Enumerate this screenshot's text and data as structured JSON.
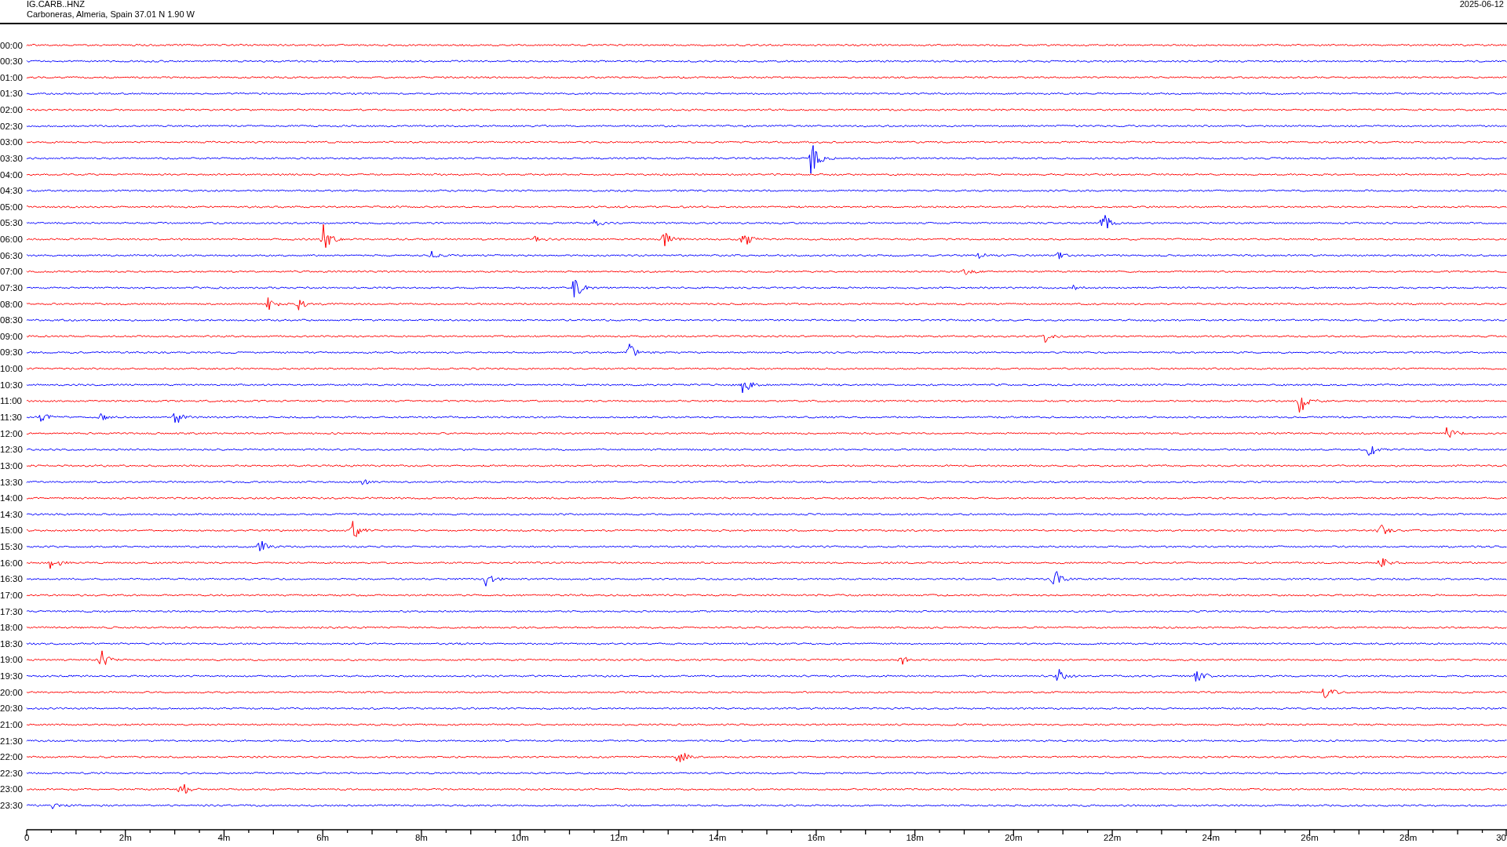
{
  "header": {
    "station": "IG.CARB..HNZ",
    "location": "Carboneras, Almeria, Spain  37.01 N 1.90 W",
    "date": "2025-06-12"
  },
  "rows": [
    {
      "time": "00:00",
      "color": "#ff0000"
    },
    {
      "time": "00:30",
      "color": "#0000ff"
    },
    {
      "time": "01:00",
      "color": "#ff0000"
    },
    {
      "time": "01:30",
      "color": "#0000ff"
    },
    {
      "time": "02:00",
      "color": "#ff0000"
    },
    {
      "time": "02:30",
      "color": "#0000ff"
    },
    {
      "time": "03:00",
      "color": "#ff0000"
    },
    {
      "time": "03:30",
      "color": "#0000ff"
    },
    {
      "time": "04:00",
      "color": "#ff0000"
    },
    {
      "time": "04:30",
      "color": "#0000ff"
    },
    {
      "time": "05:00",
      "color": "#ff0000"
    },
    {
      "time": "05:30",
      "color": "#0000ff"
    },
    {
      "time": "06:00",
      "color": "#ff0000"
    },
    {
      "time": "06:30",
      "color": "#0000ff"
    },
    {
      "time": "07:00",
      "color": "#ff0000"
    },
    {
      "time": "07:30",
      "color": "#0000ff"
    },
    {
      "time": "08:00",
      "color": "#ff0000"
    },
    {
      "time": "08:30",
      "color": "#0000ff"
    },
    {
      "time": "09:00",
      "color": "#ff0000"
    },
    {
      "time": "09:30",
      "color": "#0000ff"
    },
    {
      "time": "10:00",
      "color": "#ff0000"
    },
    {
      "time": "10:30",
      "color": "#0000ff"
    },
    {
      "time": "11:00",
      "color": "#ff0000"
    },
    {
      "time": "11:30",
      "color": "#0000ff"
    },
    {
      "time": "12:00",
      "color": "#ff0000"
    },
    {
      "time": "12:30",
      "color": "#0000ff"
    },
    {
      "time": "13:00",
      "color": "#ff0000"
    },
    {
      "time": "13:30",
      "color": "#0000ff"
    },
    {
      "time": "14:00",
      "color": "#ff0000"
    },
    {
      "time": "14:30",
      "color": "#0000ff"
    },
    {
      "time": "15:00",
      "color": "#ff0000"
    },
    {
      "time": "15:30",
      "color": "#0000ff"
    },
    {
      "time": "16:00",
      "color": "#ff0000"
    },
    {
      "time": "16:30",
      "color": "#0000ff"
    },
    {
      "time": "17:00",
      "color": "#ff0000"
    },
    {
      "time": "17:30",
      "color": "#0000ff"
    },
    {
      "time": "18:00",
      "color": "#ff0000"
    },
    {
      "time": "18:30",
      "color": "#0000ff"
    },
    {
      "time": "19:00",
      "color": "#ff0000"
    },
    {
      "time": "19:30",
      "color": "#0000ff"
    },
    {
      "time": "20:00",
      "color": "#ff0000"
    },
    {
      "time": "20:30",
      "color": "#0000ff"
    },
    {
      "time": "21:00",
      "color": "#ff0000"
    },
    {
      "time": "21:30",
      "color": "#0000ff"
    },
    {
      "time": "22:00",
      "color": "#ff0000"
    },
    {
      "time": "22:30",
      "color": "#0000ff"
    },
    {
      "time": "23:00",
      "color": "#ff0000"
    },
    {
      "time": "23:30",
      "color": "#0000ff"
    }
  ],
  "x_axis": {
    "labels": [
      "0",
      "2m",
      "4m",
      "6m",
      "8m",
      "10m",
      "12m",
      "14m",
      "16m",
      "18m",
      "20m",
      "22m",
      "24m",
      "26m",
      "28m",
      "30"
    ]
  }
}
